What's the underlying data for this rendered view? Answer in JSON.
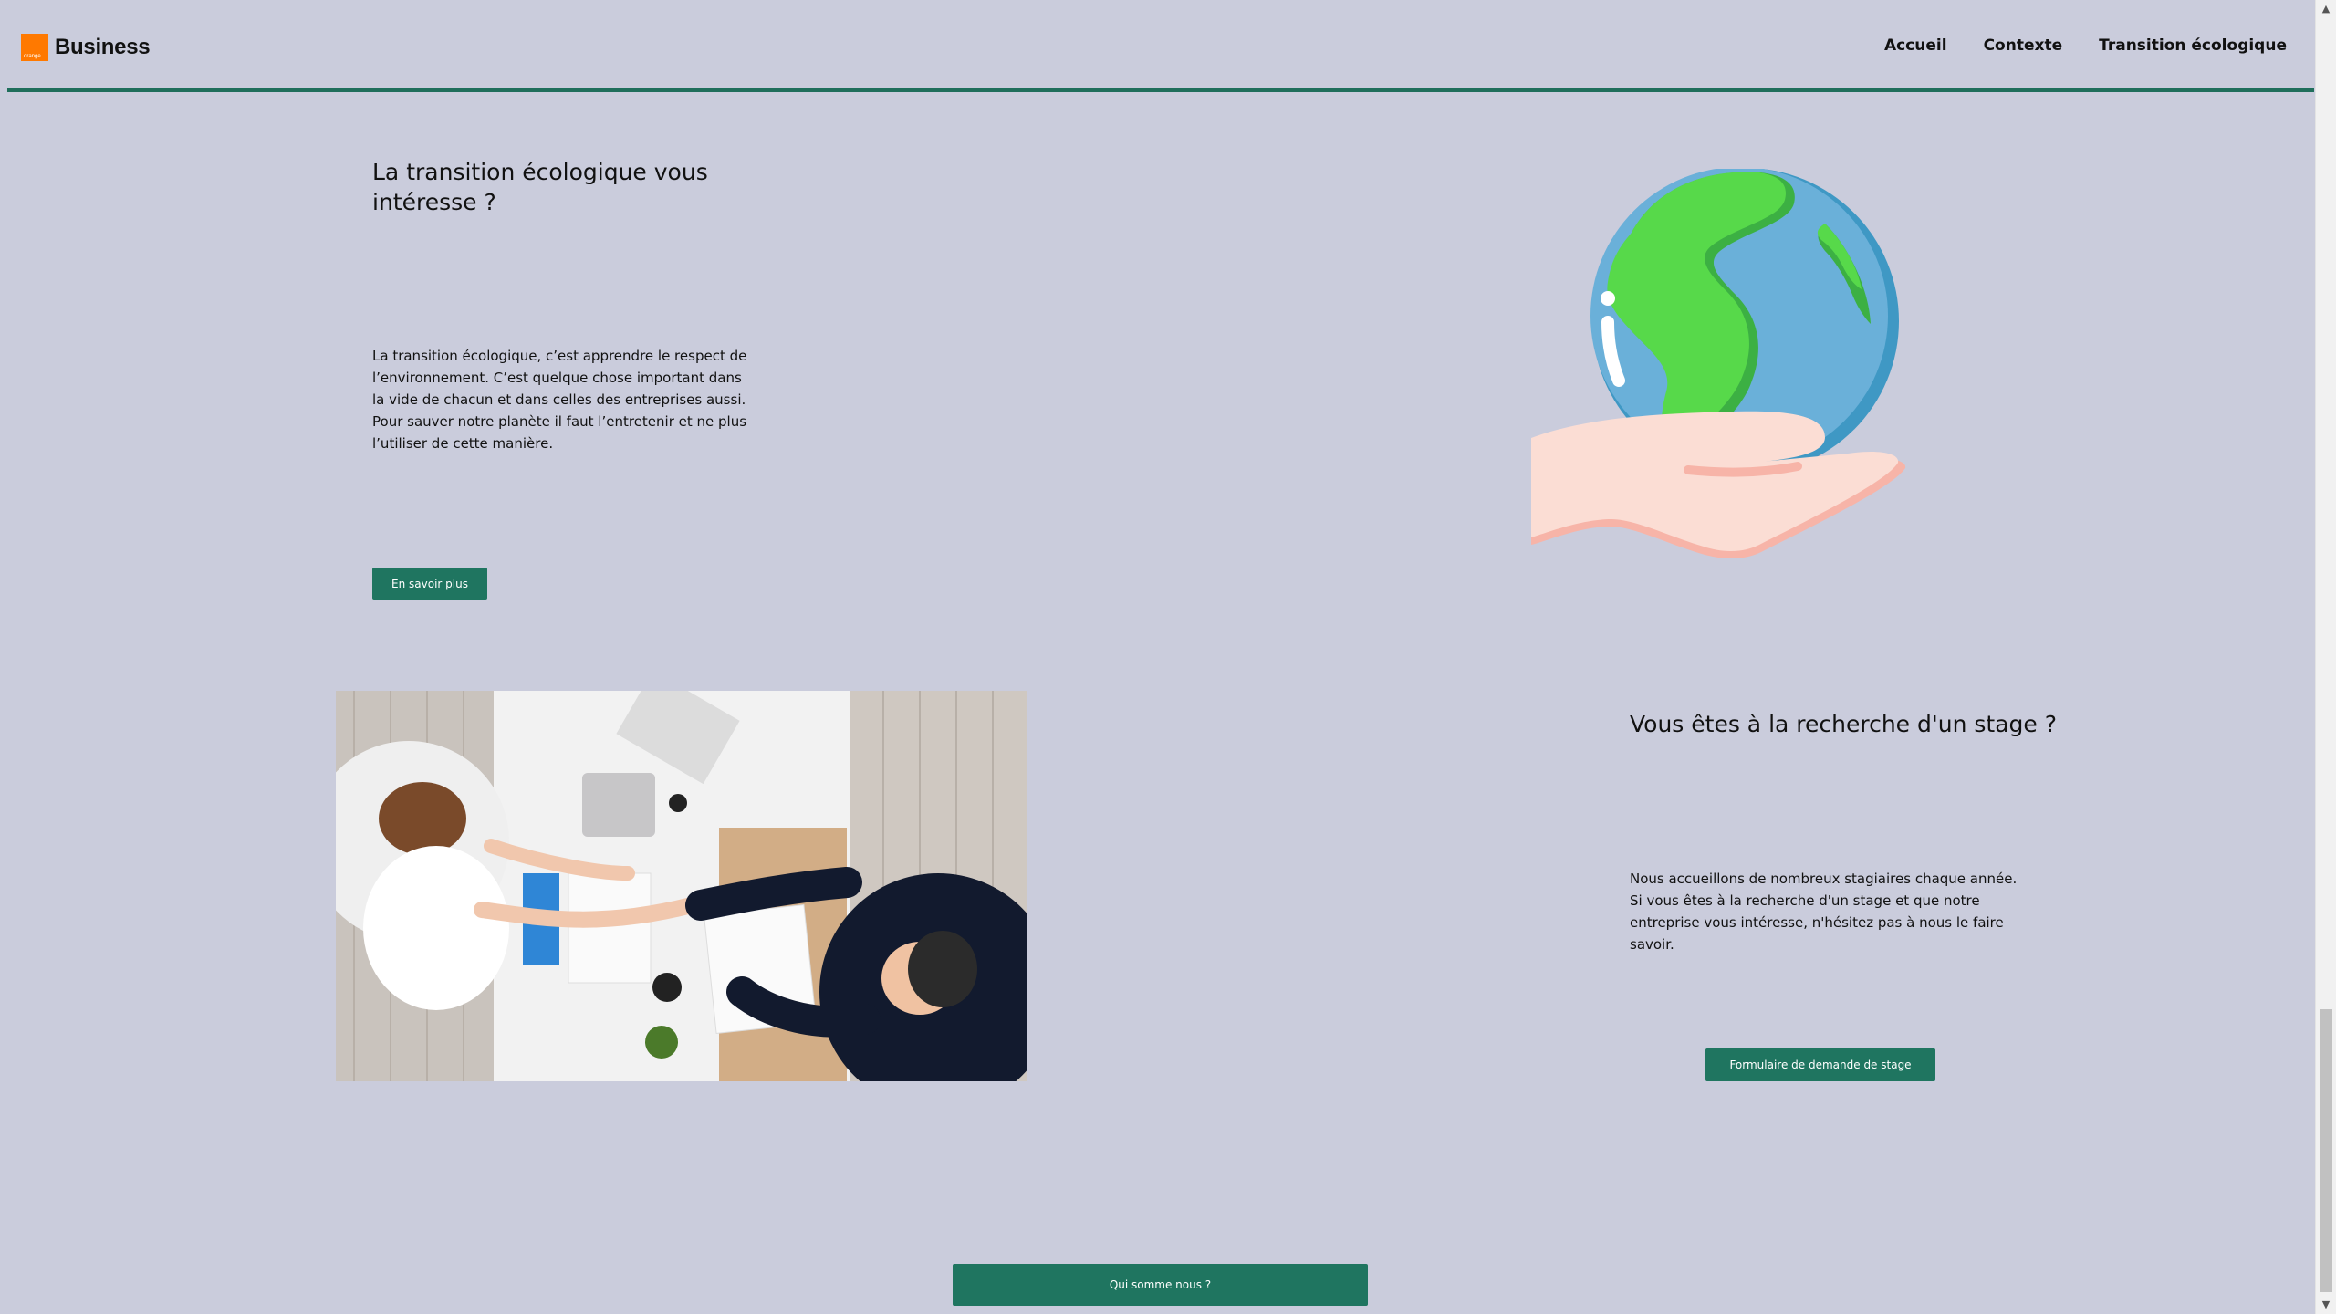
{
  "header": {
    "logo_small_text": "orange",
    "brand": "Business",
    "nav": [
      "Accueil",
      "Contexte",
      "Transition écologique"
    ]
  },
  "section_ecology": {
    "title": "La transition écologique vous intéresse ?",
    "text": "La transition écologique, c’est apprendre le respect de l’environnement. C’est quelque chose important dans la vide de chacun et dans celles des entreprises aussi. Pour sauver notre planète il faut l’entretenir et ne plus l’utiliser de cette manière.",
    "button": "En savoir plus"
  },
  "section_internship": {
    "title": "Vous êtes à la recherche d'un stage ?",
    "text": "Nous accueillons de nombreux stagiaires chaque année. Si vous êtes à la recherche d'un stage et que notre entreprise vous intéresse, n'hésitez pas à nous le faire savoir.",
    "button": "Formulaire de demande de stage"
  },
  "footer": {
    "button": "Qui somme nous ?"
  },
  "colors": {
    "background": "#caccdc",
    "accent": "#1f7560",
    "header_rule": "#1f6e5b",
    "brand_orange": "#ff7900"
  },
  "icons": [
    "globe-in-hand-illustration",
    "scroll-up-arrow-icon",
    "scroll-down-arrow-icon"
  ]
}
